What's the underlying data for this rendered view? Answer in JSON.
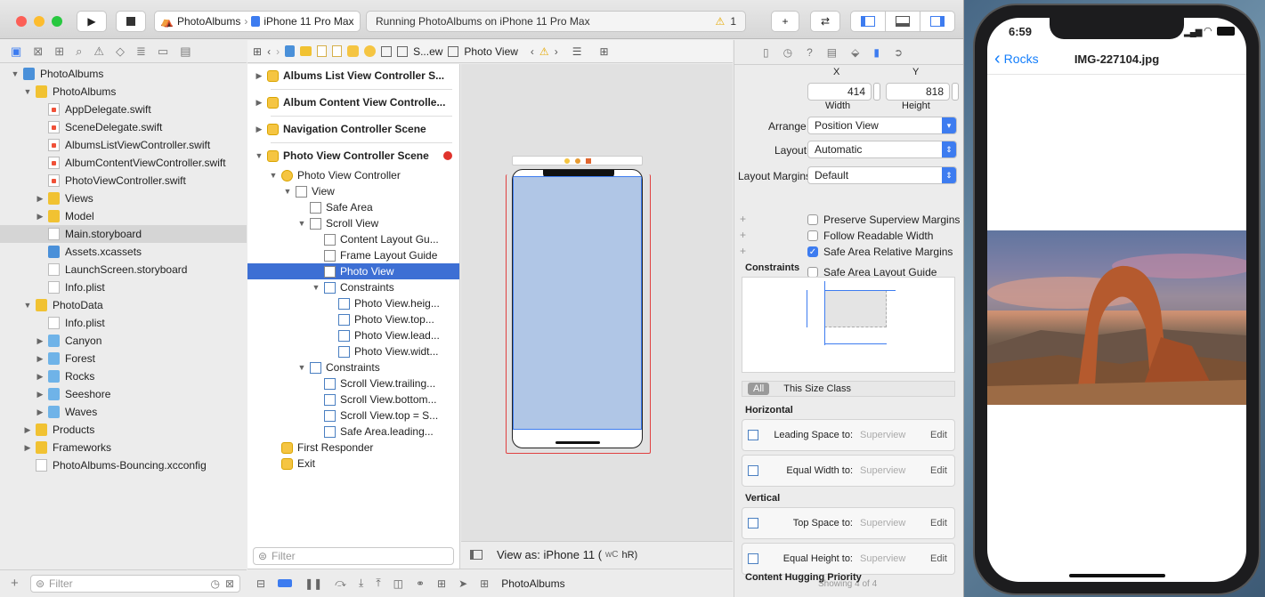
{
  "toolbar": {
    "project": "PhotoAlbums",
    "device": "iPhone 11 Pro Max",
    "status": "Running PhotoAlbums on iPhone 11 Pro Max",
    "warning_count": "1"
  },
  "navigator": {
    "items": [
      {
        "label": "PhotoAlbums",
        "kind": "project",
        "depth": 0,
        "disc": "▼"
      },
      {
        "label": "PhotoAlbums",
        "kind": "folder-y",
        "depth": 1,
        "disc": "▼"
      },
      {
        "label": "AppDelegate.swift",
        "kind": "swift",
        "depth": 2,
        "disc": ""
      },
      {
        "label": "SceneDelegate.swift",
        "kind": "swift",
        "depth": 2,
        "disc": ""
      },
      {
        "label": "AlbumsListViewController.swift",
        "kind": "swift",
        "depth": 2,
        "disc": ""
      },
      {
        "label": "AlbumContentViewController.swift",
        "kind": "swift",
        "depth": 2,
        "disc": ""
      },
      {
        "label": "PhotoViewController.swift",
        "kind": "swift",
        "depth": 2,
        "disc": ""
      },
      {
        "label": "Views",
        "kind": "folder-y",
        "depth": 2,
        "disc": "▶"
      },
      {
        "label": "Model",
        "kind": "folder-y",
        "depth": 2,
        "disc": "▶"
      },
      {
        "label": "Main.storyboard",
        "kind": "plist",
        "depth": 2,
        "disc": "",
        "selected": true
      },
      {
        "label": "Assets.xcassets",
        "kind": "blue",
        "depth": 2,
        "disc": ""
      },
      {
        "label": "LaunchScreen.storyboard",
        "kind": "plist",
        "depth": 2,
        "disc": ""
      },
      {
        "label": "Info.plist",
        "kind": "plist",
        "depth": 2,
        "disc": ""
      },
      {
        "label": "PhotoData",
        "kind": "folder-y",
        "depth": 1,
        "disc": "▼"
      },
      {
        "label": "Info.plist",
        "kind": "plist",
        "depth": 2,
        "disc": ""
      },
      {
        "label": "Canyon",
        "kind": "folder-b",
        "depth": 2,
        "disc": "▶"
      },
      {
        "label": "Forest",
        "kind": "folder-b",
        "depth": 2,
        "disc": "▶"
      },
      {
        "label": "Rocks",
        "kind": "folder-b",
        "depth": 2,
        "disc": "▶"
      },
      {
        "label": "Seeshore",
        "kind": "folder-b",
        "depth": 2,
        "disc": "▶"
      },
      {
        "label": "Waves",
        "kind": "folder-b",
        "depth": 2,
        "disc": "▶"
      },
      {
        "label": "Products",
        "kind": "folder-y",
        "depth": 1,
        "disc": "▶"
      },
      {
        "label": "Frameworks",
        "kind": "folder-y",
        "depth": 1,
        "disc": "▶"
      },
      {
        "label": "PhotoAlbums-Bouncing.xcconfig",
        "kind": "plist",
        "depth": 1,
        "disc": ""
      }
    ],
    "filter_placeholder": "Filter"
  },
  "jumpbar": {
    "crumb1": "S...ew",
    "crumb2": "Photo View"
  },
  "outline": {
    "items": [
      {
        "label": "Albums List View Controller S...",
        "depth": 0,
        "disc": "▶",
        "icon": "scene",
        "bold": true
      },
      {
        "label": "Album Content View Controlle...",
        "depth": 0,
        "disc": "▶",
        "icon": "scene",
        "bold": true
      },
      {
        "label": "Navigation Controller Scene",
        "depth": 0,
        "disc": "▶",
        "icon": "scene",
        "bold": true
      },
      {
        "label": "Photo View Controller Scene",
        "depth": 0,
        "disc": "▼",
        "icon": "scene",
        "bold": true
      },
      {
        "label": "Photo View Controller",
        "depth": 1,
        "disc": "▼",
        "icon": "circle"
      },
      {
        "label": "View",
        "depth": 2,
        "disc": "▼",
        "icon": "view"
      },
      {
        "label": "Safe Area",
        "depth": 3,
        "disc": "",
        "icon": "view"
      },
      {
        "label": "Scroll View",
        "depth": 3,
        "disc": "▼",
        "icon": "view"
      },
      {
        "label": "Content Layout Gu...",
        "depth": 4,
        "disc": "",
        "icon": "view"
      },
      {
        "label": "Frame Layout Guide",
        "depth": 4,
        "disc": "",
        "icon": "view"
      },
      {
        "label": "Photo View",
        "depth": 4,
        "disc": "",
        "icon": "view",
        "selected": true
      },
      {
        "label": "Constraints",
        "depth": 4,
        "disc": "▼",
        "icon": "con"
      },
      {
        "label": "Photo View.heig...",
        "depth": 5,
        "disc": "",
        "icon": "con"
      },
      {
        "label": "Photo View.top...",
        "depth": 5,
        "disc": "",
        "icon": "con"
      },
      {
        "label": "Photo View.lead...",
        "depth": 5,
        "disc": "",
        "icon": "con"
      },
      {
        "label": "Photo View.widt...",
        "depth": 5,
        "disc": "",
        "icon": "con"
      },
      {
        "label": "Constraints",
        "depth": 3,
        "disc": "▼",
        "icon": "con"
      },
      {
        "label": "Scroll View.trailing...",
        "depth": 4,
        "disc": "",
        "icon": "con"
      },
      {
        "label": "Scroll View.bottom...",
        "depth": 4,
        "disc": "",
        "icon": "con"
      },
      {
        "label": "Scroll View.top = S...",
        "depth": 4,
        "disc": "",
        "icon": "con"
      },
      {
        "label": "Safe Area.leading...",
        "depth": 4,
        "disc": "",
        "icon": "con"
      },
      {
        "label": "First Responder",
        "depth": 1,
        "disc": "",
        "icon": "resp"
      },
      {
        "label": "Exit",
        "depth": 1,
        "disc": "",
        "icon": "exit"
      }
    ],
    "filter_placeholder": "Filter"
  },
  "canvas": {
    "view_as": "View as: iPhone 11 (",
    "size_w": "wC",
    "size_h": "hR)",
    "bottom_scheme": "PhotoAlbums"
  },
  "inspector": {
    "x_label": "X",
    "y_label": "Y",
    "width_value": "414",
    "height_value": "818",
    "width_label": "Width",
    "height_label": "Height",
    "arrange_label": "Arrange",
    "arrange_value": "Position View",
    "layout_label": "Layout",
    "layout_value": "Automatic",
    "margins_label": "Layout Margins",
    "margins_value": "Default",
    "checks": [
      {
        "label": "Preserve Superview Margins",
        "checked": false
      },
      {
        "label": "Follow Readable Width",
        "checked": false
      },
      {
        "label": "Safe Area Relative Margins",
        "checked": true
      },
      {
        "label": "Safe Area Layout Guide",
        "checked": false
      }
    ],
    "constraints_title": "Constraints",
    "seg_all": "All",
    "seg_size": "This Size Class",
    "horizontal_title": "Horizontal",
    "vertical_title": "Vertical",
    "constraints": [
      {
        "label": "Leading Space to:",
        "target": "Superview",
        "edit": "Edit"
      },
      {
        "label": "Equal Width to:",
        "target": "Superview",
        "edit": "Edit"
      },
      {
        "label": "Top Space to:",
        "target": "Superview",
        "edit": "Edit"
      },
      {
        "label": "Equal Height to:",
        "target": "Superview",
        "edit": "Edit"
      }
    ],
    "showing": "Showing 4 of 4",
    "hugging_title": "Content Hugging Priority"
  },
  "simulator": {
    "time": "6:59",
    "back_label": "Rocks",
    "title": "IMG-227104.jpg"
  },
  "colors": {
    "accent": "#3d7cf0",
    "selection": "#3d6fd4",
    "canvas_view": "#b0c6e6"
  }
}
